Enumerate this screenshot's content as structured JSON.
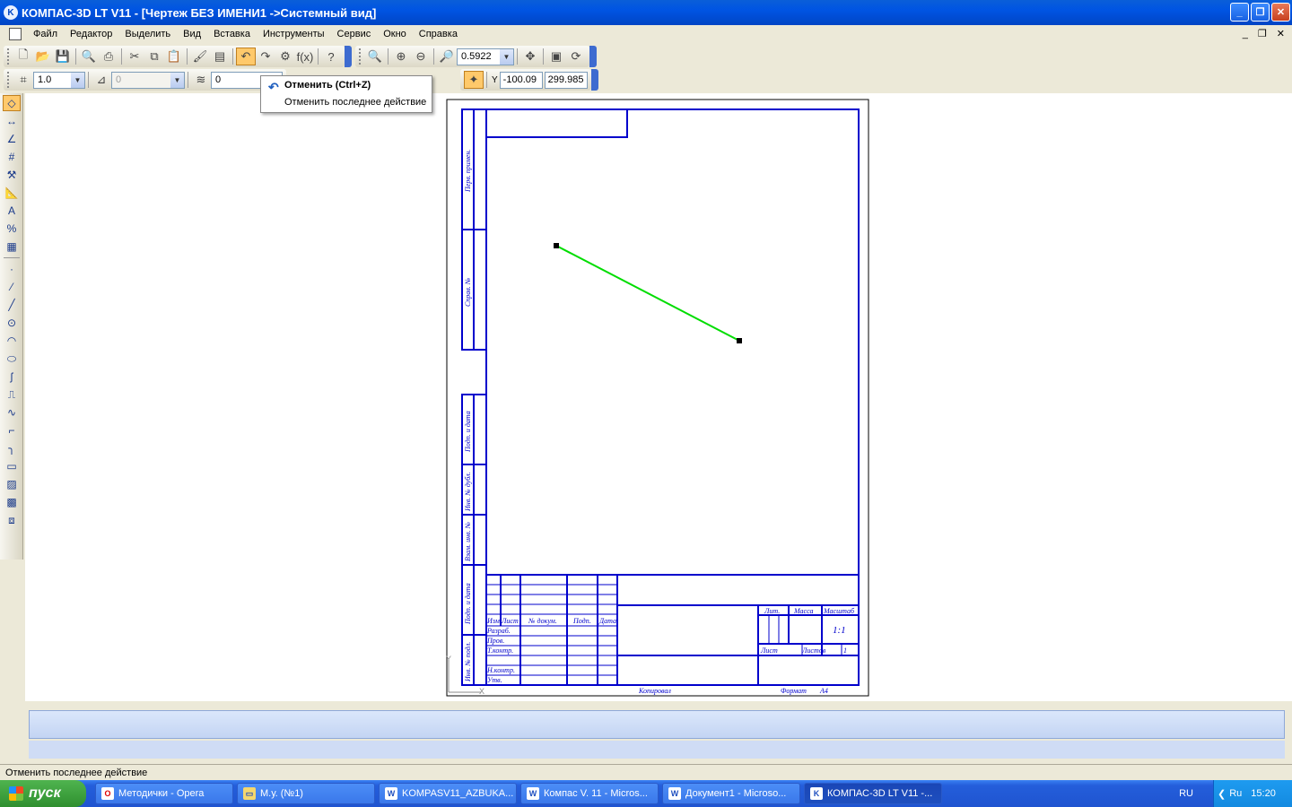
{
  "window": {
    "title": "КОМПАС-3D LT V11 - [Чертеж БЕЗ ИМЕНИ1 ->Системный вид]",
    "icon": "kompas-app-icon"
  },
  "menu": [
    "Файл",
    "Редактор",
    "Выделить",
    "Вид",
    "Вставка",
    "Инструменты",
    "Сервис",
    "Окно",
    "Справка"
  ],
  "toolbar": {
    "zoom_value": "0.5922",
    "step_value": "1.0",
    "angle_value": "0",
    "layer_value": "0",
    "coord_x": "-100.09",
    "coord_y": "299.985",
    "coord_label": "Y"
  },
  "tooltip": {
    "title": "Отменить (Ctrl+Z)",
    "description": "Отменить последнее действие"
  },
  "drawing": {
    "line_color": "#00dd00",
    "frame_color": "#0000cc",
    "side_labels": [
      "Перв. примен.",
      "Справ. №",
      "Подп. и дата",
      "Инв. № дубл.",
      "Взам. инв. №",
      "Подп. и дата",
      "Инв. № подл."
    ],
    "stamp_headers": [
      "Изм",
      "Лист",
      "№ докум.",
      "Подп.",
      "Дата"
    ],
    "stamp_roles": [
      "Разраб.",
      "Пров.",
      "Т.контр.",
      "Н.контр.",
      "Утв."
    ],
    "stamp_right": [
      "Лит.",
      "Масса",
      "Масштаб"
    ],
    "scale": "1:1",
    "sheet_label": "Лист",
    "sheets_label": "Листов",
    "sheets_count": "1",
    "copied": "Копировал",
    "format": "Формат",
    "format_value": "A4",
    "axis_y": "Y",
    "axis_x": "X"
  },
  "status": "Отменить последнее действие",
  "taskbar": {
    "start": "пуск",
    "tasks": [
      {
        "label": "Методички - Opera",
        "icon": "opera-icon"
      },
      {
        "label": "М.у. (№1)",
        "icon": "folder-icon"
      },
      {
        "label": "KOMPASV11_AZBUKA...",
        "icon": "word-icon"
      },
      {
        "label": "Компас V. 11 - Micros...",
        "icon": "word-icon"
      },
      {
        "label": "Документ1 - Microso...",
        "icon": "word-icon"
      },
      {
        "label": "КОМПАС-3D LT V11 -...",
        "icon": "kompas-icon"
      }
    ],
    "lang": "RU",
    "tray_lang": "Ru",
    "clock": "15:20"
  }
}
